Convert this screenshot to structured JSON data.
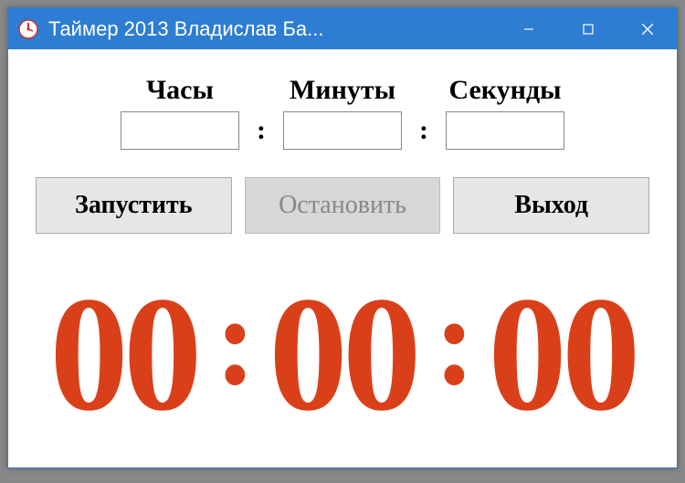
{
  "window": {
    "title": "Таймер 2013 Владислав Ба..."
  },
  "labels": {
    "hours": "Часы",
    "minutes": "Минуты",
    "seconds": "Секунды"
  },
  "separators": {
    "input_colon": ":",
    "display_colon": ":"
  },
  "inputs": {
    "hours": "",
    "minutes": "",
    "seconds": ""
  },
  "buttons": {
    "start": "Запустить",
    "stop": "Остановить",
    "exit": "Выход"
  },
  "display": {
    "hours": "00",
    "minutes": "00",
    "seconds": "00"
  },
  "colors": {
    "titlebar": "#2d7dd2",
    "display": "#d9401a"
  }
}
